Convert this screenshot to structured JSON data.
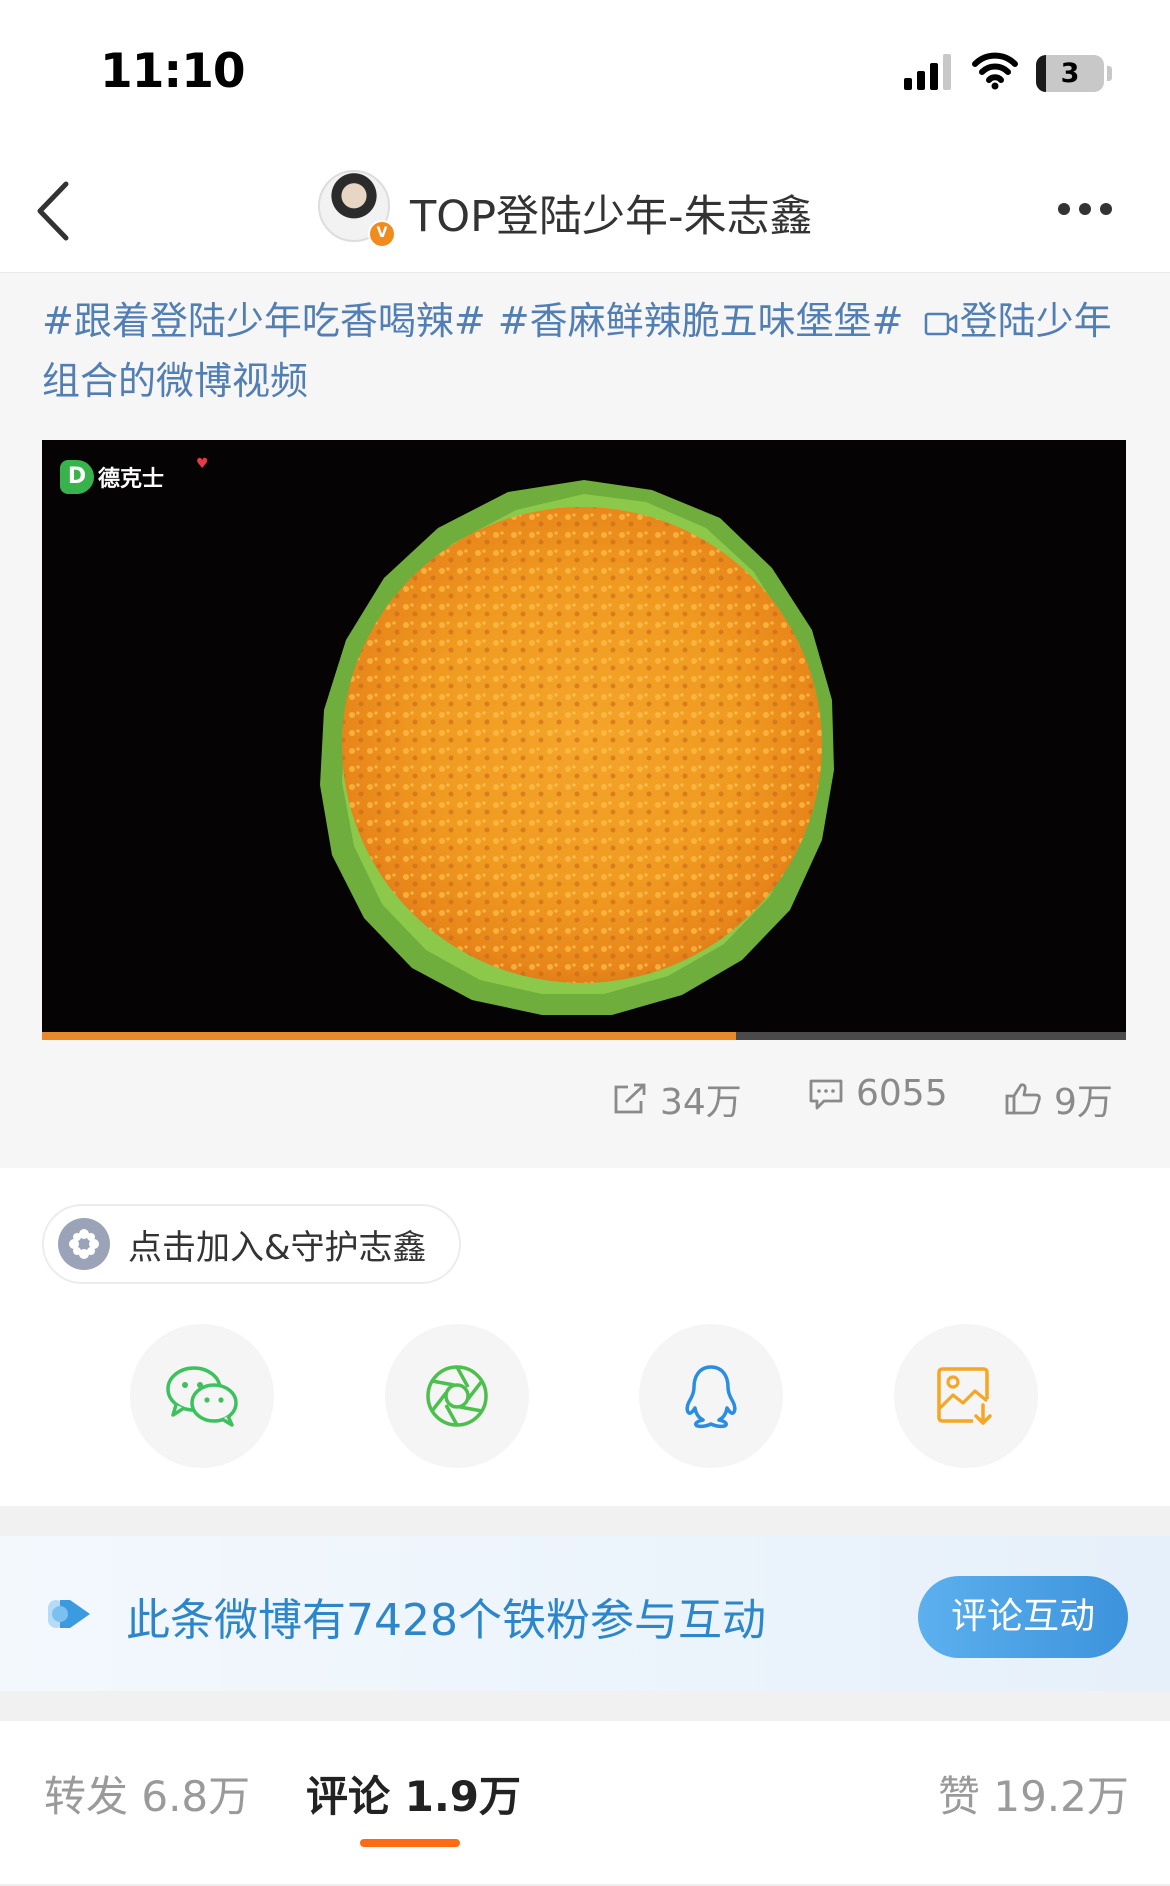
{
  "status_bar": {
    "time": "11:10",
    "battery": "3",
    "battery_level": 0.14
  },
  "nav": {
    "title": "TOP登陆少年-朱志鑫",
    "verified_badge": "V"
  },
  "post": {
    "hashtag_1": "#跟着登陆少年吃香喝辣#",
    "hashtag_2": "#香麻鲜辣脆五味堡堡#",
    "video_link": "登陆少年组合的微博视频",
    "video": {
      "logo_mark": "D",
      "logo_text": "德克士",
      "progress": 0.64
    },
    "stats": {
      "reposts": "34万",
      "comments": "6055",
      "likes": "9万"
    }
  },
  "fan_chip": {
    "label": "点击加入&守护志鑫"
  },
  "share": {
    "targets": [
      "wechat-icon",
      "moments-icon",
      "qq-icon",
      "save-image-icon"
    ]
  },
  "fan_banner": {
    "text": "此条微博有7428个铁粉参与互动",
    "button": "评论互动"
  },
  "tabs": {
    "repost": "转发 6.8万",
    "comments": "评论 1.9万",
    "likes": "赞 19.2万"
  },
  "colors": {
    "link_blue": "#527fb3",
    "accent_orange": "#ff6a13",
    "progress_orange": "#e8892c",
    "banner_blue": "#2d86c9"
  }
}
